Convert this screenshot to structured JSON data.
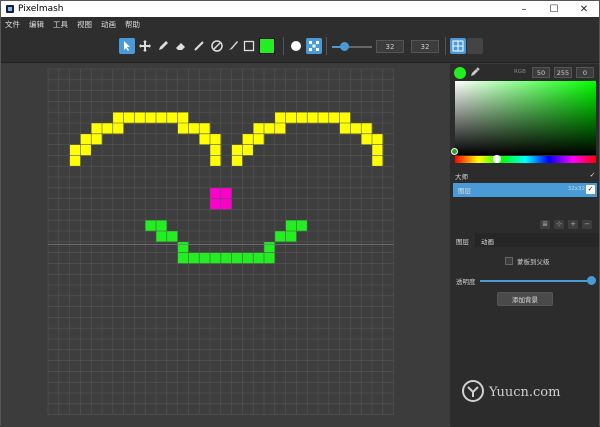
{
  "window": {
    "title": "Pixelmash",
    "minimize": "–",
    "maximize": "☐",
    "close": "✕"
  },
  "menu": [
    "文件",
    "编辑",
    "工具",
    "视图",
    "动画",
    "帮助"
  ],
  "toolbar": {
    "tools": [
      {
        "name": "select-tool",
        "icon": "cursor-icon",
        "active": true
      },
      {
        "name": "move-tool",
        "icon": "move-arrows-icon",
        "active": false
      },
      {
        "name": "pencil-tool",
        "icon": "pencil-icon",
        "active": false
      },
      {
        "name": "eraser-tool",
        "icon": "eraser-icon",
        "active": false
      },
      {
        "name": "line-tool",
        "icon": "line-icon",
        "active": false
      },
      {
        "name": "fill-tool",
        "icon": "fill-icon",
        "active": false
      },
      {
        "name": "brush-tool",
        "icon": "brush-icon",
        "active": false
      },
      {
        "name": "rect-tool",
        "icon": "square-icon",
        "active": false
      }
    ],
    "color": "#22ee22",
    "brush_shapes": [
      {
        "name": "round-brush",
        "icon": "circle-icon",
        "active": false
      },
      {
        "name": "scatter-brush",
        "icon": "dots-icon",
        "active": true
      }
    ],
    "size_slider": 0.2,
    "width": "32",
    "height": "32",
    "view_modes": [
      {
        "name": "grid-view",
        "icon": "grid-icon",
        "active": true
      },
      {
        "name": "single-view",
        "icon": "blank-icon",
        "active": false
      }
    ]
  },
  "canvas": {
    "cells": 32,
    "pixels": [
      {
        "color": "#ffff00",
        "cells": [
          [
            6,
            4
          ],
          [
            7,
            4
          ],
          [
            8,
            4
          ],
          [
            9,
            4
          ],
          [
            10,
            4
          ],
          [
            11,
            4
          ],
          [
            12,
            4
          ],
          [
            4,
            5
          ],
          [
            5,
            5
          ],
          [
            6,
            5
          ],
          [
            12,
            5
          ],
          [
            13,
            5
          ],
          [
            14,
            5
          ],
          [
            3,
            6
          ],
          [
            4,
            6
          ],
          [
            14,
            6
          ],
          [
            15,
            6
          ],
          [
            2,
            7
          ],
          [
            3,
            7
          ],
          [
            15,
            7
          ],
          [
            2,
            8
          ],
          [
            15,
            8
          ],
          [
            21,
            4
          ],
          [
            22,
            4
          ],
          [
            23,
            4
          ],
          [
            24,
            4
          ],
          [
            25,
            4
          ],
          [
            26,
            4
          ],
          [
            27,
            4
          ],
          [
            19,
            5
          ],
          [
            20,
            5
          ],
          [
            21,
            5
          ],
          [
            27,
            5
          ],
          [
            28,
            5
          ],
          [
            29,
            5
          ],
          [
            18,
            6
          ],
          [
            19,
            6
          ],
          [
            29,
            6
          ],
          [
            30,
            6
          ],
          [
            17,
            7
          ],
          [
            18,
            7
          ],
          [
            30,
            7
          ],
          [
            17,
            8
          ],
          [
            30,
            8
          ]
        ]
      },
      {
        "color": "#ff00cc",
        "cells": [
          [
            15,
            11
          ],
          [
            16,
            11
          ],
          [
            15,
            12
          ],
          [
            16,
            12
          ]
        ]
      },
      {
        "color": "#22ee22",
        "cells": [
          [
            9,
            14
          ],
          [
            10,
            14
          ],
          [
            22,
            14
          ],
          [
            23,
            14
          ],
          [
            10,
            15
          ],
          [
            11,
            15
          ],
          [
            21,
            15
          ],
          [
            22,
            15
          ],
          [
            12,
            16
          ],
          [
            20,
            16
          ],
          [
            12,
            17
          ],
          [
            13,
            17
          ],
          [
            14,
            17
          ],
          [
            15,
            17
          ],
          [
            16,
            17
          ],
          [
            17,
            17
          ],
          [
            18,
            17
          ],
          [
            19,
            17
          ],
          [
            20,
            17
          ]
        ]
      }
    ]
  },
  "palette": {
    "current_color": "#22ee22",
    "rgb_label": "RGB",
    "r": "50",
    "g": "255",
    "b": "0",
    "hue_position": 0.3,
    "sv_knob": "bottom-left"
  },
  "layers": [
    {
      "name": "大师",
      "dims": "",
      "visible": true,
      "selected": false
    },
    {
      "name": "图层",
      "dims": "32x32",
      "visible": true,
      "selected": true
    }
  ],
  "layer_tools": [
    "≣",
    "⊹",
    "+",
    "−"
  ],
  "tabs": [
    {
      "label": "图层",
      "active": true
    },
    {
      "label": "动画",
      "active": false
    }
  ],
  "properties": {
    "clip_label": "蒙板到父级",
    "opacity_label": "透明度",
    "opacity": 1.0,
    "add_bg_label": "添加背景"
  },
  "watermark": "Yuucn.com"
}
